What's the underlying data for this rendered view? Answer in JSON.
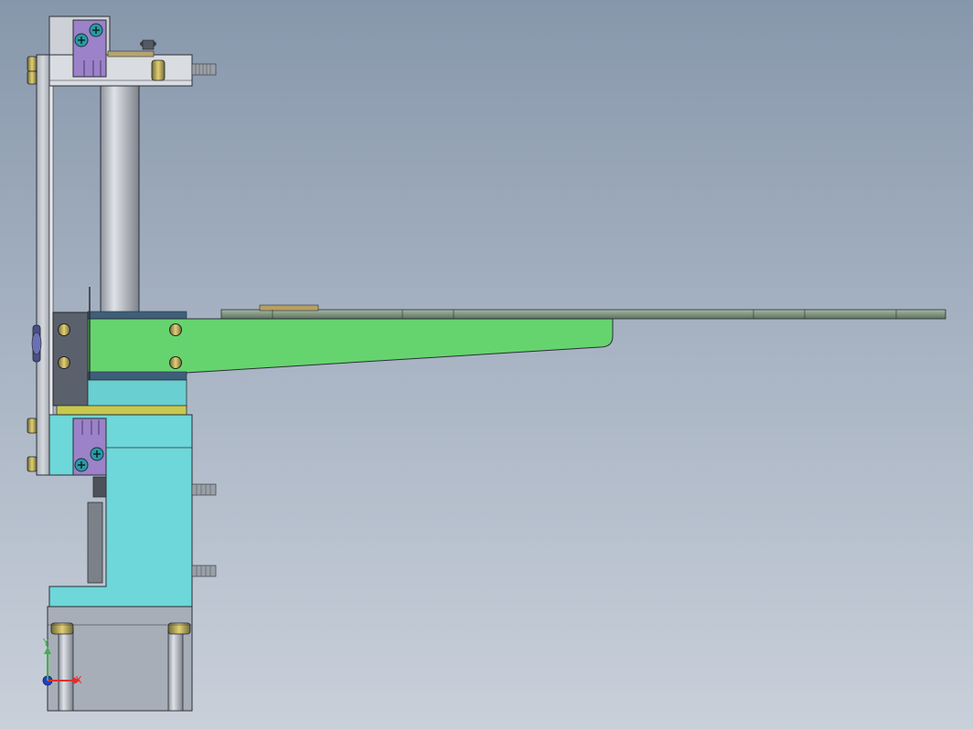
{
  "view": {
    "background_top": "#8797ab",
    "background_bottom": "#c9d0da"
  },
  "colors": {
    "frame": "#c8ccd2",
    "frame_edge": "#2b2f36",
    "rod": "#b9bec8",
    "arm": "#66d46e",
    "plate": "#8fa596",
    "cyan_block": "#6dd7d9",
    "purple_clip": "#9c82c8",
    "screw_head": "#2a9aa5",
    "bolt": "#c9b25a",
    "dark_block": "#5b616c",
    "navy_band": "#3e5f7a"
  },
  "triad": {
    "x_label": "X",
    "y_label": "Y",
    "x_color": "#e0302a",
    "y_color": "#3cb34a",
    "z_color": "#2440c8"
  }
}
